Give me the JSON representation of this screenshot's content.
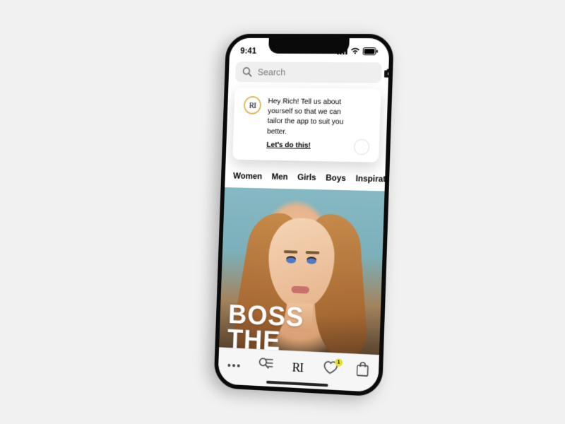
{
  "status": {
    "time": "9:41"
  },
  "search": {
    "placeholder": "Search"
  },
  "promo": {
    "logo_text": "RI",
    "message": "Hey Rich! Tell us about yourself so that we can tailor the app to suit you better.",
    "cta": "Let's do this!"
  },
  "categories": {
    "items": [
      "Women",
      "Men",
      "Girls",
      "Boys",
      "Inspiration"
    ],
    "active_index": 0
  },
  "hero": {
    "line1": "BOSS",
    "line2": "THE"
  },
  "tabbar": {
    "logo_text": "RI",
    "wishlist_badge": "1"
  }
}
